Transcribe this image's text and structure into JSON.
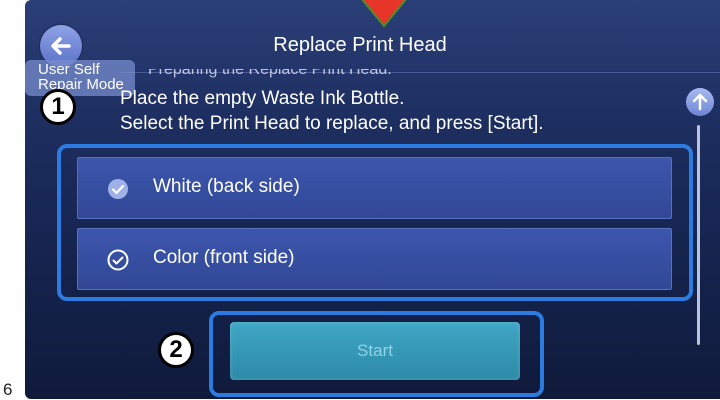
{
  "step_number": "6",
  "header": {
    "title": "Replace Print Head",
    "mode_label_line1": "User Self",
    "mode_label_line2": "Repair Mode"
  },
  "instructions": {
    "partial_line": "Preparing the Replace Print Head.",
    "line1": "Place the empty Waste Ink Bottle.",
    "line2": "Select the Print Head to replace, and press [Start]."
  },
  "options": [
    {
      "label": "White (back side)",
      "selected": true
    },
    {
      "label": "Color (front side)",
      "selected": false
    }
  ],
  "start_button": {
    "label": "Start",
    "enabled": false
  },
  "callouts": {
    "one": "①",
    "two": "②"
  },
  "colors": {
    "highlight_frame": "#2b7be0",
    "option_bg": "#3d56ad",
    "start_bg": "#3fa7c4",
    "pointer_arrow": "#e8352a"
  },
  "icons": {
    "back": "back-arrow-icon",
    "scroll_up": "scroll-up-icon",
    "option_check": "check-circle-icon",
    "pointer": "red-down-arrow-icon"
  }
}
